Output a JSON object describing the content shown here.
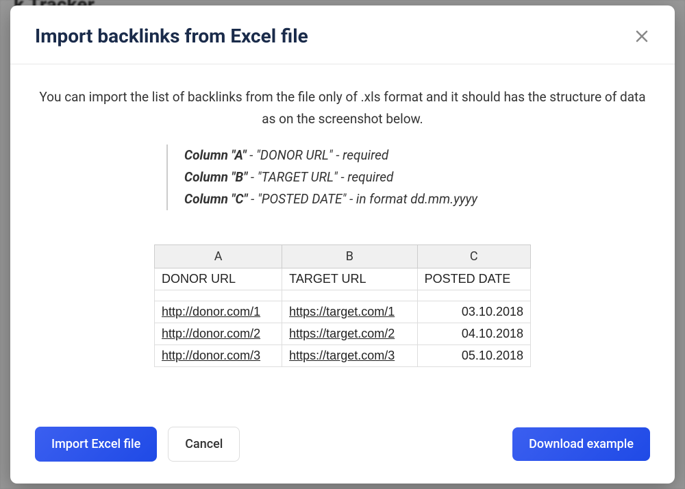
{
  "backdrop": {
    "title_fragment": "k Tracker"
  },
  "modal": {
    "title": "Import backlinks from Excel file",
    "intro": "You can import the list of backlinks from the file only of .xls format and it should has the structure of data as on the screenshot below.",
    "columns": [
      {
        "label": "Column \"A\"",
        "name": "\"DONOR URL\"",
        "note": "required"
      },
      {
        "label": "Column \"B\"",
        "name": "\"TARGET URL\"",
        "note": "required"
      },
      {
        "label": "Column \"C\"",
        "name": "\"POSTED DATE\"",
        "note": "in format dd.mm.yyyy"
      }
    ],
    "table": {
      "col_letters": [
        "A",
        "B",
        "C"
      ],
      "headers": [
        "DONOR URL",
        "TARGET URL",
        "POSTED DATE"
      ],
      "rows": [
        {
          "donor": "http://donor.com/1",
          "target": "https://target.com/1",
          "date": "03.10.2018"
        },
        {
          "donor": "http://donor.com/2",
          "target": "https://target.com/2",
          "date": "04.10.2018"
        },
        {
          "donor": "http://donor.com/3",
          "target": "https://target.com/3",
          "date": "05.10.2018"
        }
      ]
    },
    "buttons": {
      "import": "Import Excel file",
      "cancel": "Cancel",
      "download": "Download example"
    }
  }
}
